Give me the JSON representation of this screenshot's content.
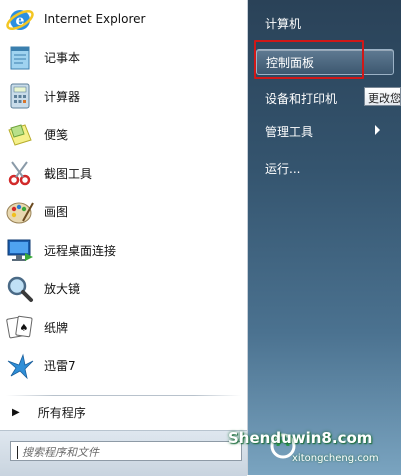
{
  "programs": [
    {
      "label": "Internet Explorer",
      "icon": "internet-explorer-icon"
    },
    {
      "label": "记事本",
      "icon": "notepad-icon"
    },
    {
      "label": "计算器",
      "icon": "calculator-icon"
    },
    {
      "label": "便笺",
      "icon": "sticky-notes-icon"
    },
    {
      "label": "截图工具",
      "icon": "snipping-tool-icon"
    },
    {
      "label": "画图",
      "icon": "paint-icon"
    },
    {
      "label": "远程桌面连接",
      "icon": "remote-desktop-icon"
    },
    {
      "label": "放大镜",
      "icon": "magnifier-icon"
    },
    {
      "label": "纸牌",
      "icon": "solitaire-icon"
    },
    {
      "label": "迅雷7",
      "icon": "thunder-icon"
    }
  ],
  "all_programs": "所有程序",
  "search": {
    "placeholder": "搜索程序和文件"
  },
  "right_menu": {
    "computer": "计算机",
    "control_panel": "控制面板",
    "devices_printers": "设备和打印机",
    "admin_tools": "管理工具",
    "run": "运行..."
  },
  "tooltip": "更改您",
  "watermark": {
    "main": "Shenduwin8.com",
    "sub": "xitongcheng.com"
  },
  "colors": {
    "highlight_border": "#d01818",
    "right_panel_top": "#2a4258",
    "right_panel_bottom": "#7aa4c0"
  }
}
